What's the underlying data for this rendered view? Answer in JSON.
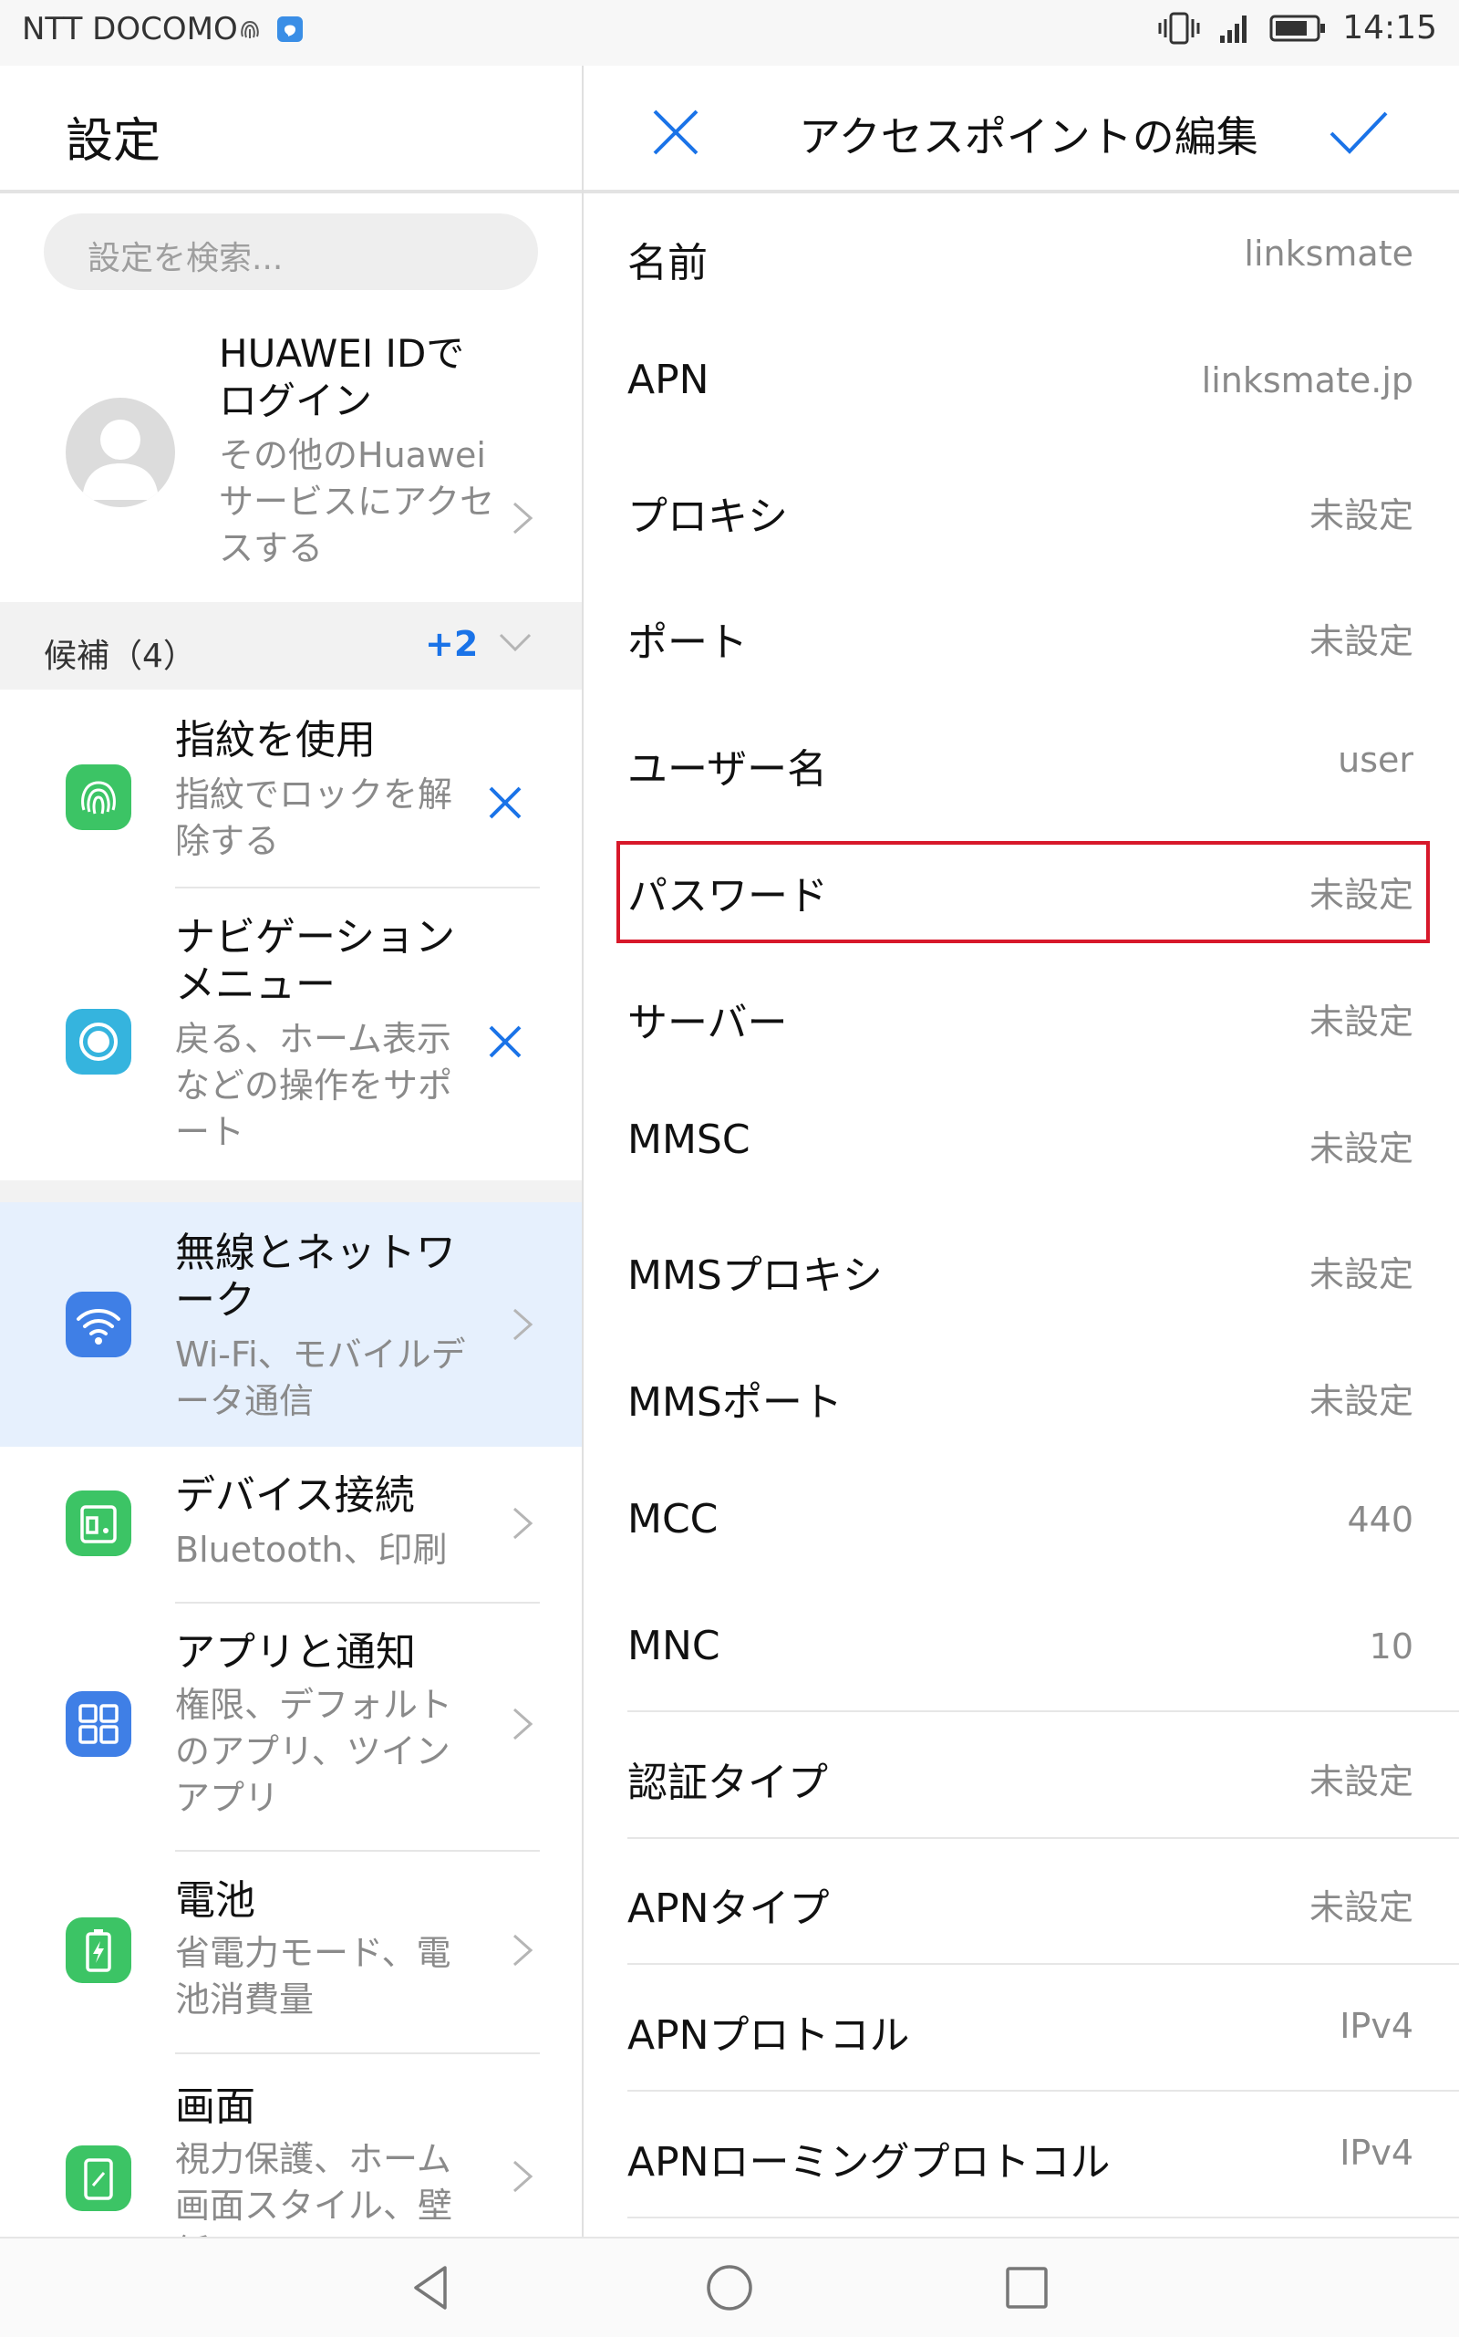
{
  "status_bar": {
    "carrier": "NTT DOCOMO",
    "time": "14:15"
  },
  "left": {
    "title": "設定",
    "search_placeholder": "設定を検索...",
    "account": {
      "title": "HUAWEI IDでログイン",
      "subtitle": "その他のHuaweiサービスにアクセスする"
    },
    "candidates": {
      "label": "候補（4）",
      "more": "+2"
    },
    "suggestions": [
      {
        "title": "指紋を使用",
        "subtitle": "指紋でロックを解除する"
      },
      {
        "title": "ナビゲーションメニュー",
        "subtitle": "戻る、ホーム表示などの操作をサポート"
      }
    ],
    "settings": [
      {
        "title": "無線とネットワーク",
        "subtitle": "Wi-Fi、モバイルデータ通信"
      },
      {
        "title": "デバイス接続",
        "subtitle": "Bluetooth、印刷"
      },
      {
        "title": "アプリと通知",
        "subtitle": "権限、デフォルトのアプリ、ツインアプリ"
      },
      {
        "title": "電池",
        "subtitle": "省電力モード、電池消費量"
      },
      {
        "title": "画面",
        "subtitle": "視力保護、ホーム画面スタイル、壁紙"
      }
    ]
  },
  "right": {
    "title": "アクセスポイントの編集",
    "fields": [
      {
        "label": "名前",
        "value": "linksmate"
      },
      {
        "label": "APN",
        "value": "linksmate.jp"
      },
      {
        "label": "プロキシ",
        "value": "未設定"
      },
      {
        "label": "ポート",
        "value": "未設定"
      },
      {
        "label": "ユーザー名",
        "value": "user"
      },
      {
        "label": "パスワード",
        "value": "未設定"
      },
      {
        "label": "サーバー",
        "value": "未設定"
      },
      {
        "label": "MMSC",
        "value": "未設定"
      },
      {
        "label": "MMSプロキシ",
        "value": "未設定"
      },
      {
        "label": "MMSポート",
        "value": "未設定"
      },
      {
        "label": "MCC",
        "value": "440"
      },
      {
        "label": "MNC",
        "value": "10"
      },
      {
        "label": "認証タイプ",
        "value": "未設定"
      },
      {
        "label": "APNタイプ",
        "value": "未設定"
      },
      {
        "label": "APNプロトコル",
        "value": "IPv4"
      },
      {
        "label": "APNローミングプロトコル",
        "value": "IPv4"
      }
    ]
  },
  "colors": {
    "accent": "#1a73e8",
    "highlight_box": "#d7182a",
    "selected_row_bg": "#e6f0fd"
  }
}
